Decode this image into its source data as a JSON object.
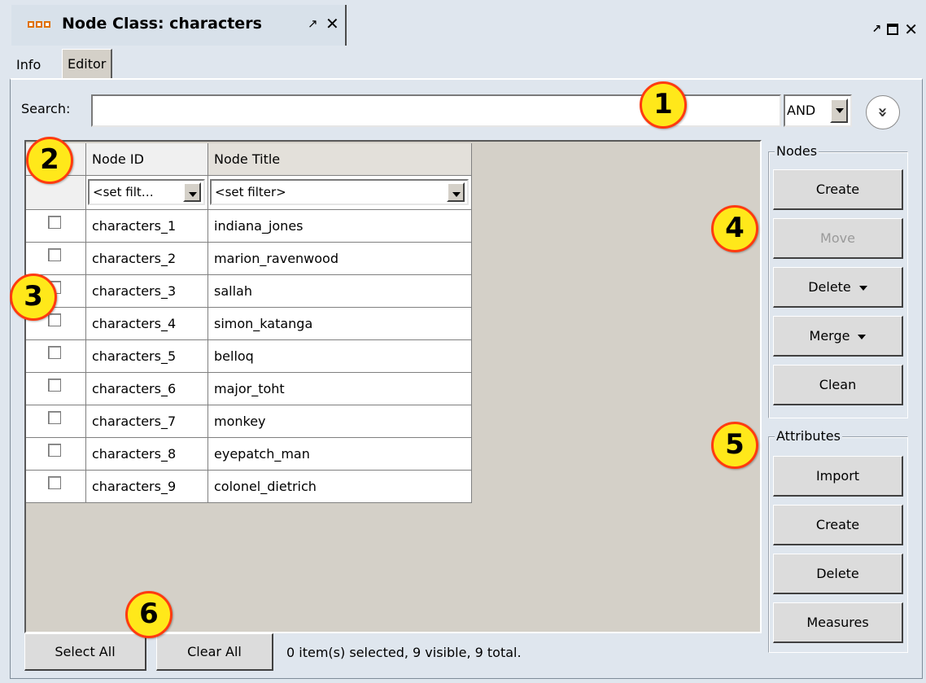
{
  "window": {
    "tab_title": "Node Class: characters",
    "pin_glyph": "↗",
    "close_glyph": "✕"
  },
  "subtabs": {
    "info": "Info",
    "editor": "Editor"
  },
  "search": {
    "label": "Search:",
    "value": "",
    "operator": "AND",
    "expand_glyph": "»"
  },
  "table": {
    "columns": [
      "Node ID",
      "Node Title"
    ],
    "filters": [
      "<set filt…",
      "<set filter>"
    ],
    "rows": [
      {
        "id": "characters_1",
        "title": "indiana_jones"
      },
      {
        "id": "characters_2",
        "title": "marion_ravenwood"
      },
      {
        "id": "characters_3",
        "title": "sallah"
      },
      {
        "id": "characters_4",
        "title": "simon_katanga"
      },
      {
        "id": "characters_5",
        "title": "belloq"
      },
      {
        "id": "characters_6",
        "title": "major_toht"
      },
      {
        "id": "characters_7",
        "title": "monkey"
      },
      {
        "id": "characters_8",
        "title": "eyepatch_man"
      },
      {
        "id": "characters_9",
        "title": "colonel_dietrich"
      }
    ]
  },
  "nodes_group": {
    "title": "Nodes",
    "create": "Create",
    "move": "Move",
    "delete": "Delete",
    "merge": "Merge",
    "clean": "Clean"
  },
  "attributes_group": {
    "title": "Attributes",
    "import": "Import",
    "create": "Create",
    "delete": "Delete",
    "measures": "Measures"
  },
  "footer": {
    "select_all": "Select All",
    "clear_all": "Clear All",
    "status": "0 item(s) selected, 9 visible, 9 total."
  },
  "callouts": [
    "1",
    "2",
    "3",
    "4",
    "5",
    "6"
  ],
  "colors": {
    "callout_fill": "#ffe81a",
    "callout_border": "#ff3b10",
    "icon_orange": "#e07000"
  }
}
